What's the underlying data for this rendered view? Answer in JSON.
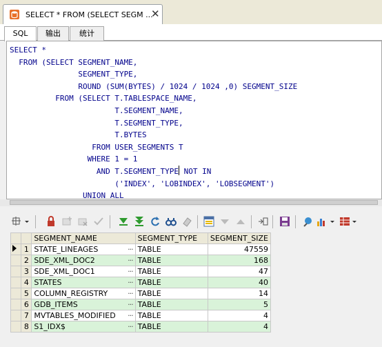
{
  "window": {
    "doc_tab_title": "SELECT * FROM (SELECT SEGM ...",
    "close_glyph": "✕"
  },
  "editor_tabs": [
    "SQL",
    "输出",
    "统计"
  ],
  "sql_lines": [
    "SELECT *",
    "  FROM (SELECT SEGMENT_NAME,",
    "               SEGMENT_TYPE,",
    "               ROUND (SUM(BYTES) / 1024 / 1024 ,0) SEGMENT_SIZE",
    "          FROM (SELECT T.TABLESPACE_NAME,",
    "                       T.SEGMENT_NAME,",
    "                       T.SEGMENT_TYPE,",
    "                       T.BYTES",
    "                  FROM USER_SEGMENTS T",
    "                 WHERE 1 = 1",
    "                   AND T.SEGMENT_TYPE",
    "                       ('INDEX', 'LOBINDEX', 'LOBSEGMENT')",
    "                UNION ALL"
  ],
  "sql_line_11_tail": " NOT IN",
  "grid": {
    "columns": [
      "SEGMENT_NAME",
      "SEGMENT_TYPE",
      "SEGMENT_SIZE"
    ],
    "rows": [
      {
        "n": "1",
        "name": "STATE_LINEAGES",
        "type": "TABLE",
        "size": "47559"
      },
      {
        "n": "2",
        "name": "SDE_XML_DOC2",
        "type": "TABLE",
        "size": "168"
      },
      {
        "n": "3",
        "name": "SDE_XML_DOC1",
        "type": "TABLE",
        "size": "47"
      },
      {
        "n": "4",
        "name": "STATES",
        "type": "TABLE",
        "size": "40"
      },
      {
        "n": "5",
        "name": "COLUMN_REGISTRY",
        "type": "TABLE",
        "size": "14"
      },
      {
        "n": "6",
        "name": "GDB_ITEMS",
        "type": "TABLE",
        "size": "5"
      },
      {
        "n": "7",
        "name": "MVTABLES_MODIFIED",
        "type": "TABLE",
        "size": "4"
      },
      {
        "n": "8",
        "name": "S1_IDX$",
        "type": "TABLE",
        "size": "4"
      }
    ],
    "ellipsis": "···"
  },
  "colors": {
    "sql_text": "#00008b",
    "row_alt": "#d9f3d9",
    "green_arrows": "#2e9a2e",
    "lock_red": "#c0392b"
  },
  "toolbar_icons": [
    "grid-options-icon",
    "lock-icon",
    "add-record-icon",
    "delete-record-icon",
    "post-icon",
    "fetch-next-icon",
    "fetch-last-icon",
    "refresh-icon",
    "find-icon",
    "clear-icon",
    "query-builder-icon",
    "filter-down-icon",
    "filter-up-icon",
    "export-icon",
    "save-icon",
    "pin-icon",
    "chart-icon",
    "table-view-icon"
  ]
}
